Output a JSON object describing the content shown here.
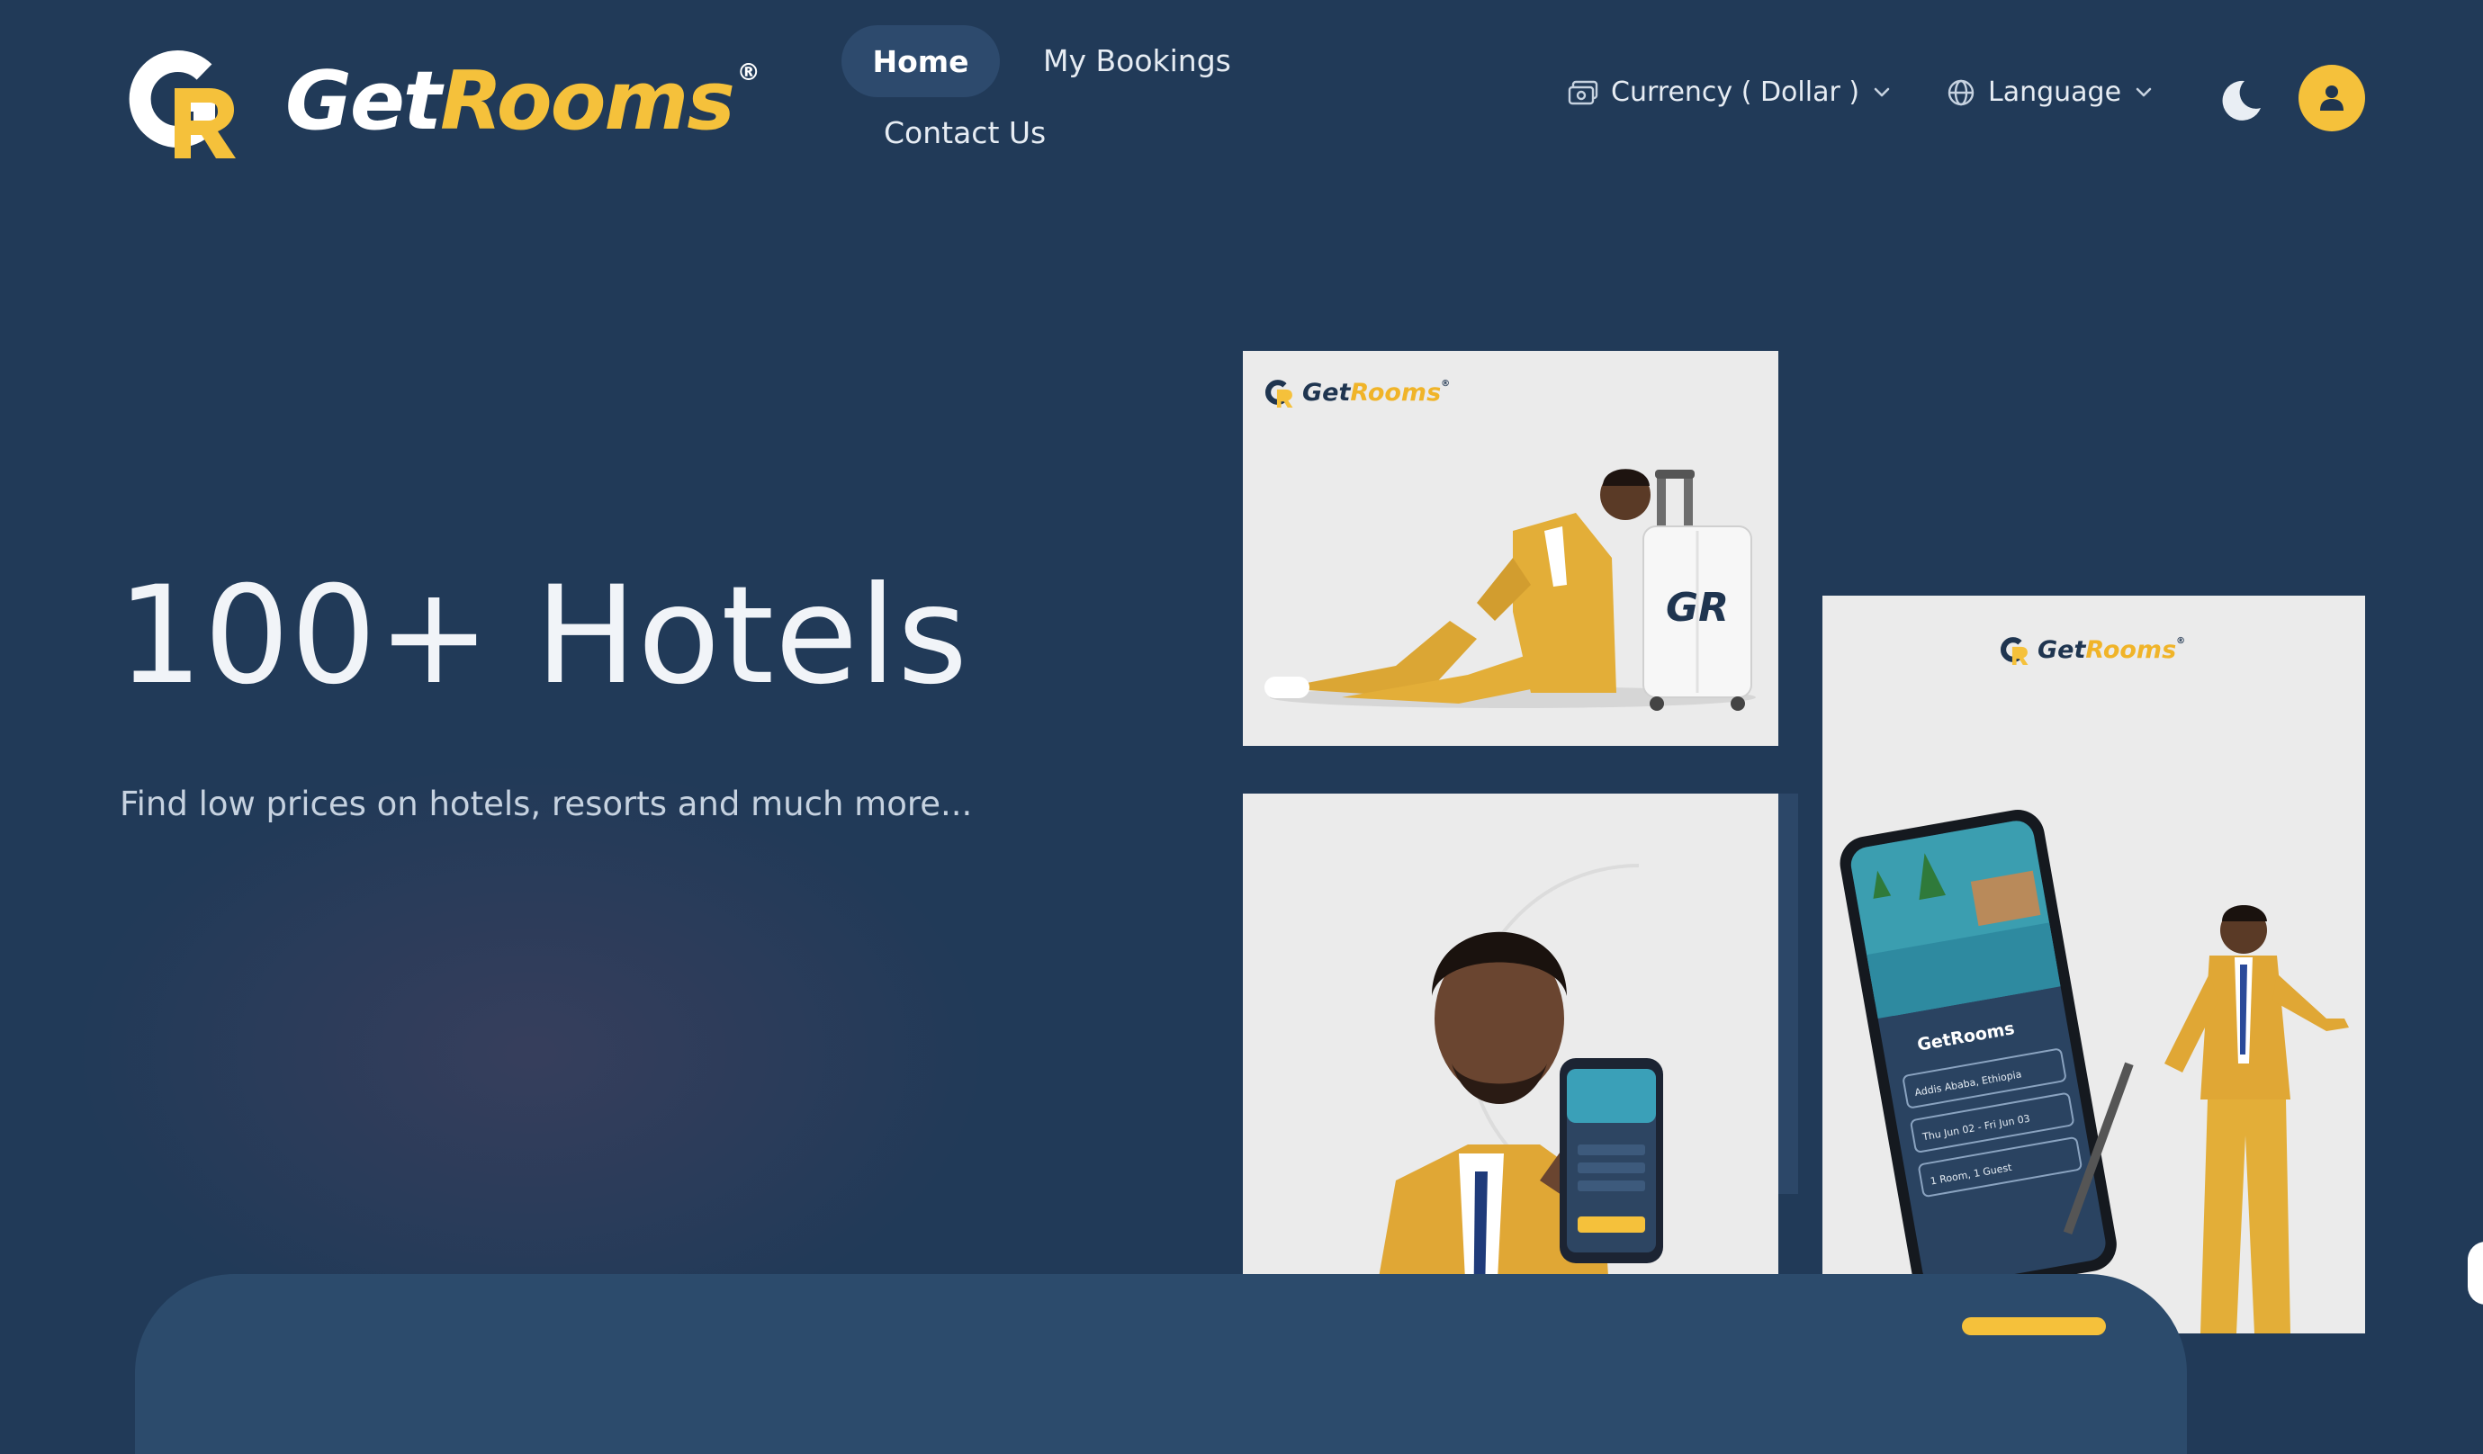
{
  "brand": {
    "name_part1": "Get",
    "name_part2": "Rooms",
    "registered": "®",
    "monogram": "GR",
    "colors": {
      "accent": "#f5c13b",
      "background": "#213a58",
      "navy": "#1f3550"
    }
  },
  "nav": {
    "home": "Home",
    "my_bookings": "My Bookings",
    "contact_us": "Contact Us"
  },
  "controls": {
    "currency": "Currency ( Dollar )",
    "language": "Language",
    "theme_icon": "moon-icon",
    "profile_icon": "user-icon"
  },
  "hero": {
    "title": "100+ Hotels",
    "subtitle": "Find low prices on hotels, resorts and much more..."
  },
  "promos": {
    "brand_part1": "Get",
    "brand_part2": "Rooms",
    "registered": "®",
    "suitcase_mark": "GR",
    "phone_app": {
      "brand": "GetRooms",
      "destination": "Addis Ababa, Ethiopia",
      "dates": "Thu Jun 02 - Fri Jun 03",
      "guests": "1 Room, 1 Guest"
    }
  }
}
